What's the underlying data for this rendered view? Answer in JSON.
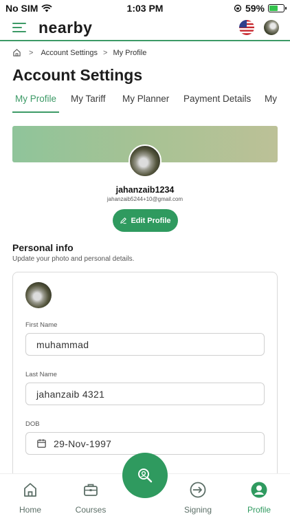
{
  "status_bar": {
    "carrier": "No SIM",
    "time": "1:03 PM",
    "battery": "59%",
    "battery_level": 0.59
  },
  "header": {
    "logo": "nearby",
    "menu_icon": "hamburger-icon",
    "language_icon": "us-flag-icon"
  },
  "breadcrumb": {
    "home_icon": "home-icon",
    "items": [
      "Account Settings",
      "My Profile"
    ]
  },
  "page": {
    "title": "Account Settings"
  },
  "tabs": [
    {
      "label": "My Profile",
      "active": true
    },
    {
      "label": "My Tariff",
      "active": false
    },
    {
      "label": "My Planner",
      "active": false
    },
    {
      "label": "Payment Details",
      "active": false
    },
    {
      "label": "My",
      "active": false
    }
  ],
  "profile": {
    "username": "jahanzaib1234",
    "email": "jahanzaib5244+10@gmail.com",
    "edit_label": "Edit Profile"
  },
  "personal_info": {
    "title": "Personal info",
    "subtitle": "Update your photo and personal details.",
    "fields": {
      "first_name": {
        "label": "First Name",
        "value": "muhammad"
      },
      "last_name": {
        "label": "Last Name",
        "value": "jahanzaib 4321"
      },
      "dob": {
        "label": "DOB",
        "value": "29-Nov-1997"
      }
    }
  },
  "bottom_nav": [
    {
      "label": "Home",
      "icon": "home-icon",
      "active": false
    },
    {
      "label": "Courses",
      "icon": "briefcase-icon",
      "active": false
    },
    {
      "label": "",
      "icon": "search-location-icon",
      "active": false
    },
    {
      "label": "Signing",
      "icon": "sign-in-icon",
      "active": false
    },
    {
      "label": "Profile",
      "icon": "profile-icon",
      "active": true
    }
  ],
  "colors": {
    "accent": "#2f9a5f",
    "nav_inactive": "#5b6e66"
  }
}
